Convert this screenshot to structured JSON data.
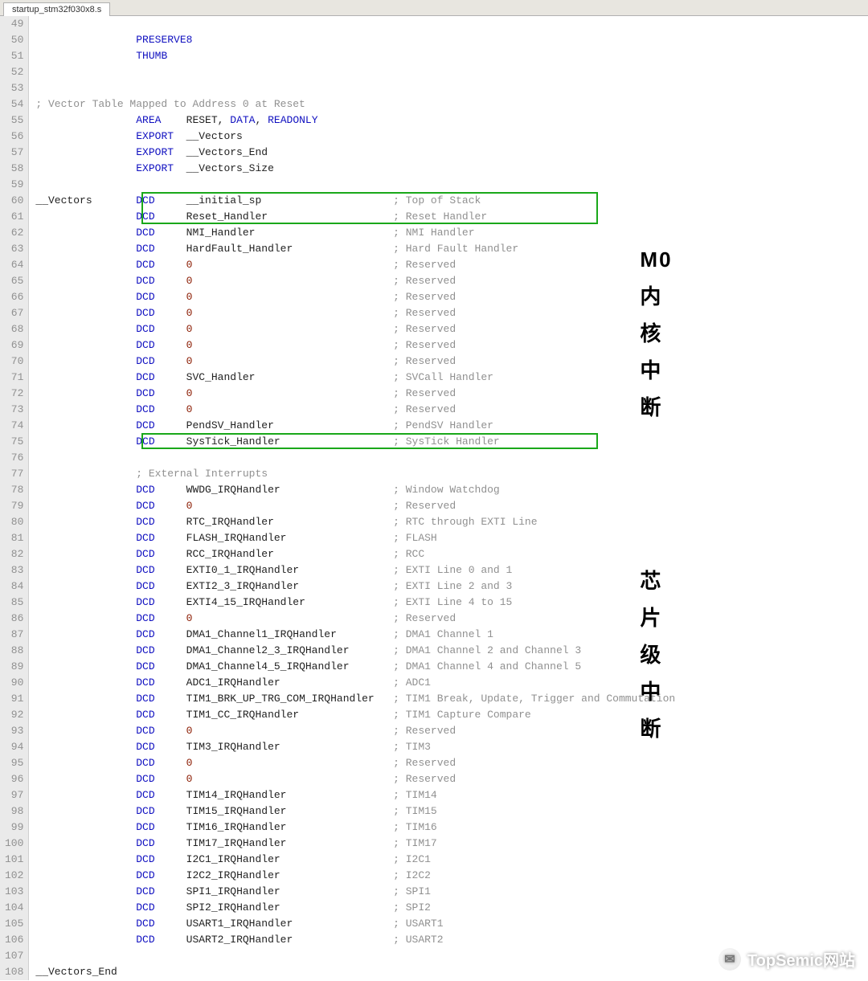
{
  "tab": {
    "name": "startup_stm32f030x8.s"
  },
  "gutter": {
    "start": 49,
    "end": 108
  },
  "annotations": {
    "core": "M0\n内\n核\n中\n断",
    "chip": "芯\n片\n级\n中\n断"
  },
  "watermark": {
    "text": "TopSemic网站"
  },
  "lines": [
    {
      "n": 49,
      "segs": []
    },
    {
      "n": 50,
      "indent": 16,
      "segs": [
        {
          "t": "PRESERVE8",
          "c": "kw"
        }
      ]
    },
    {
      "n": 51,
      "indent": 16,
      "segs": [
        {
          "t": "THUMB",
          "c": "kw"
        }
      ]
    },
    {
      "n": 52,
      "segs": []
    },
    {
      "n": 53,
      "segs": []
    },
    {
      "n": 54,
      "indent": 0,
      "segs": [
        {
          "t": "; Vector Table Mapped to Address 0 at Reset",
          "c": "cmt"
        }
      ]
    },
    {
      "n": 55,
      "indent": 16,
      "segs": [
        {
          "t": "AREA",
          "c": "kw"
        },
        {
          "t": "    RESET, ",
          "c": "ident"
        },
        {
          "t": "DATA",
          "c": "kw"
        },
        {
          "t": ", ",
          "c": "ident"
        },
        {
          "t": "READONLY",
          "c": "kw"
        }
      ]
    },
    {
      "n": 56,
      "indent": 16,
      "segs": [
        {
          "t": "EXPORT",
          "c": "kw"
        },
        {
          "t": "  __Vectors",
          "c": "ident"
        }
      ]
    },
    {
      "n": 57,
      "indent": 16,
      "segs": [
        {
          "t": "EXPORT",
          "c": "kw"
        },
        {
          "t": "  __Vectors_End",
          "c": "ident"
        }
      ]
    },
    {
      "n": 58,
      "indent": 16,
      "segs": [
        {
          "t": "EXPORT",
          "c": "kw"
        },
        {
          "t": "  __Vectors_Size",
          "c": "ident"
        }
      ]
    },
    {
      "n": 59,
      "segs": []
    },
    {
      "n": 60,
      "label": "__Vectors",
      "op": "DCD",
      "arg": "__initial_sp",
      "cmt": "Top of Stack",
      "box": "start1"
    },
    {
      "n": 61,
      "op": "DCD",
      "arg": "Reset_Handler",
      "cmt": "Reset Handler",
      "box": "end1"
    },
    {
      "n": 62,
      "op": "DCD",
      "arg": "NMI_Handler",
      "cmt": "NMI Handler"
    },
    {
      "n": 63,
      "op": "DCD",
      "arg": "HardFault_Handler",
      "cmt": "Hard Fault Handler"
    },
    {
      "n": 64,
      "op": "DCD",
      "argzero": true,
      "cmt": "Reserved"
    },
    {
      "n": 65,
      "op": "DCD",
      "argzero": true,
      "cmt": "Reserved"
    },
    {
      "n": 66,
      "op": "DCD",
      "argzero": true,
      "cmt": "Reserved"
    },
    {
      "n": 67,
      "op": "DCD",
      "argzero": true,
      "cmt": "Reserved"
    },
    {
      "n": 68,
      "op": "DCD",
      "argzero": true,
      "cmt": "Reserved"
    },
    {
      "n": 69,
      "op": "DCD",
      "argzero": true,
      "cmt": "Reserved"
    },
    {
      "n": 70,
      "op": "DCD",
      "argzero": true,
      "cmt": "Reserved"
    },
    {
      "n": 71,
      "op": "DCD",
      "arg": "SVC_Handler",
      "cmt": "SVCall Handler"
    },
    {
      "n": 72,
      "op": "DCD",
      "argzero": true,
      "cmt": "Reserved"
    },
    {
      "n": 73,
      "op": "DCD",
      "argzero": true,
      "cmt": "Reserved"
    },
    {
      "n": 74,
      "op": "DCD",
      "arg": "PendSV_Handler",
      "cmt": "PendSV Handler"
    },
    {
      "n": 75,
      "op": "DCD",
      "arg": "SysTick_Handler",
      "cmt": "SysTick Handler",
      "box": "single2"
    },
    {
      "n": 76,
      "segs": []
    },
    {
      "n": 77,
      "indent": 16,
      "segs": [
        {
          "t": "; External Interrupts",
          "c": "cmt"
        }
      ]
    },
    {
      "n": 78,
      "op": "DCD",
      "arg": "WWDG_IRQHandler",
      "cmt": "Window Watchdog"
    },
    {
      "n": 79,
      "op": "DCD",
      "argzero": true,
      "cmt": "Reserved"
    },
    {
      "n": 80,
      "op": "DCD",
      "arg": "RTC_IRQHandler",
      "cmt": "RTC through EXTI Line"
    },
    {
      "n": 81,
      "op": "DCD",
      "arg": "FLASH_IRQHandler",
      "cmt": "FLASH"
    },
    {
      "n": 82,
      "op": "DCD",
      "arg": "RCC_IRQHandler",
      "cmt": "RCC"
    },
    {
      "n": 83,
      "op": "DCD",
      "arg": "EXTI0_1_IRQHandler",
      "cmt": "EXTI Line 0 and 1"
    },
    {
      "n": 84,
      "op": "DCD",
      "arg": "EXTI2_3_IRQHandler",
      "cmt": "EXTI Line 2 and 3"
    },
    {
      "n": 85,
      "op": "DCD",
      "arg": "EXTI4_15_IRQHandler",
      "cmt": "EXTI Line 4 to 15"
    },
    {
      "n": 86,
      "op": "DCD",
      "argzero": true,
      "cmt": "Reserved"
    },
    {
      "n": 87,
      "op": "DCD",
      "arg": "DMA1_Channel1_IRQHandler",
      "cmt": "DMA1 Channel 1"
    },
    {
      "n": 88,
      "op": "DCD",
      "arg": "DMA1_Channel2_3_IRQHandler",
      "cmt": "DMA1 Channel 2 and Channel 3"
    },
    {
      "n": 89,
      "op": "DCD",
      "arg": "DMA1_Channel4_5_IRQHandler",
      "cmt": "DMA1 Channel 4 and Channel 5"
    },
    {
      "n": 90,
      "op": "DCD",
      "arg": "ADC1_IRQHandler",
      "cmt": "ADC1"
    },
    {
      "n": 91,
      "op": "DCD",
      "arg": "TIM1_BRK_UP_TRG_COM_IRQHandler",
      "cmt": "TIM1 Break, Update, Trigger and Commutation"
    },
    {
      "n": 92,
      "op": "DCD",
      "arg": "TIM1_CC_IRQHandler",
      "cmt": "TIM1 Capture Compare"
    },
    {
      "n": 93,
      "op": "DCD",
      "argzero": true,
      "cmt": "Reserved"
    },
    {
      "n": 94,
      "op": "DCD",
      "arg": "TIM3_IRQHandler",
      "cmt": "TIM3"
    },
    {
      "n": 95,
      "op": "DCD",
      "argzero": true,
      "cmt": "Reserved"
    },
    {
      "n": 96,
      "op": "DCD",
      "argzero": true,
      "cmt": "Reserved"
    },
    {
      "n": 97,
      "op": "DCD",
      "arg": "TIM14_IRQHandler",
      "cmt": "TIM14"
    },
    {
      "n": 98,
      "op": "DCD",
      "arg": "TIM15_IRQHandler",
      "cmt": "TIM15"
    },
    {
      "n": 99,
      "op": "DCD",
      "arg": "TIM16_IRQHandler",
      "cmt": "TIM16"
    },
    {
      "n": 100,
      "op": "DCD",
      "arg": "TIM17_IRQHandler",
      "cmt": "TIM17"
    },
    {
      "n": 101,
      "op": "DCD",
      "arg": "I2C1_IRQHandler",
      "cmt": "I2C1"
    },
    {
      "n": 102,
      "op": "DCD",
      "arg": "I2C2_IRQHandler",
      "cmt": "I2C2"
    },
    {
      "n": 103,
      "op": "DCD",
      "arg": "SPI1_IRQHandler",
      "cmt": "SPI1"
    },
    {
      "n": 104,
      "op": "DCD",
      "arg": "SPI2_IRQHandler",
      "cmt": "SPI2"
    },
    {
      "n": 105,
      "op": "DCD",
      "arg": "USART1_IRQHandler",
      "cmt": "USART1"
    },
    {
      "n": 106,
      "op": "DCD",
      "arg": "USART2_IRQHandler",
      "cmt": "USART2"
    },
    {
      "n": 107,
      "segs": []
    },
    {
      "n": 108,
      "label": "__Vectors_End",
      "segs": []
    }
  ]
}
